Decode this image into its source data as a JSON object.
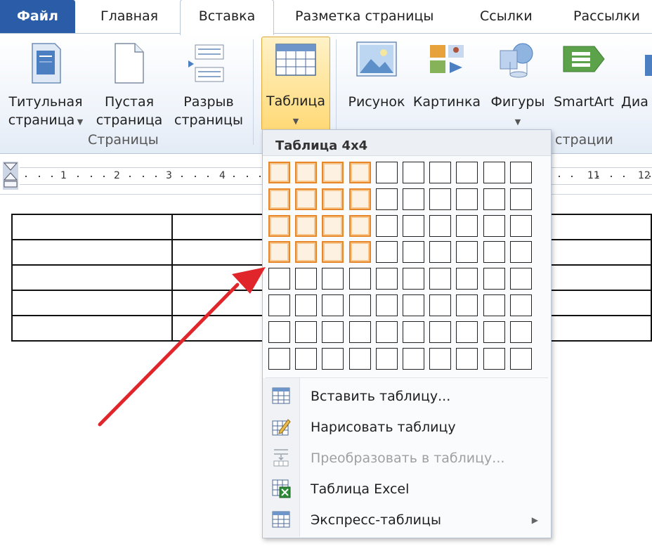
{
  "tabs": {
    "file": "Файл",
    "home": "Главная",
    "insert": "Вставка",
    "layout": "Разметка страницы",
    "references": "Ссылки",
    "mailings": "Рассылки"
  },
  "ribbon": {
    "pages_group": {
      "label": "Страницы",
      "cover_page": [
        "Титульная",
        "страница"
      ],
      "blank_page": [
        "Пустая",
        "страница"
      ],
      "page_break": [
        "Разрыв",
        "страницы"
      ]
    },
    "table_button": "Таблица",
    "picture": "Рисунок",
    "clipart": "Картинка",
    "shapes": "Фигуры",
    "smartart": "SmartArt",
    "chart_partial": "Диа",
    "illustrations_partial": "страции"
  },
  "ruler": {
    "left_labels": [
      "1",
      "2",
      "3",
      "4"
    ],
    "right_labels": [
      "11",
      "12"
    ]
  },
  "dropdown": {
    "header": "Таблица 4x4",
    "grid": {
      "columns": 10,
      "rows": 8,
      "selected_columns": 4,
      "selected_rows": 4
    },
    "items": [
      {
        "label": "Вставить таблицу...",
        "icon": "table-grid-icon",
        "disabled": false
      },
      {
        "label": "Нарисовать таблицу",
        "icon": "pencil-table-icon",
        "disabled": false
      },
      {
        "label": "Преобразовать в таблицу...",
        "icon": "convert-text-icon",
        "disabled": true
      },
      {
        "label": "Таблица Excel",
        "icon": "excel-icon",
        "disabled": false
      },
      {
        "label": "Экспресс-таблицы",
        "icon": "table-grid-icon",
        "disabled": false
      }
    ]
  },
  "annotation": {
    "arrow_color": "#e0262b"
  },
  "colors": {
    "file_tab": "#2a5ca8",
    "grid_highlight": "#e8862a"
  }
}
